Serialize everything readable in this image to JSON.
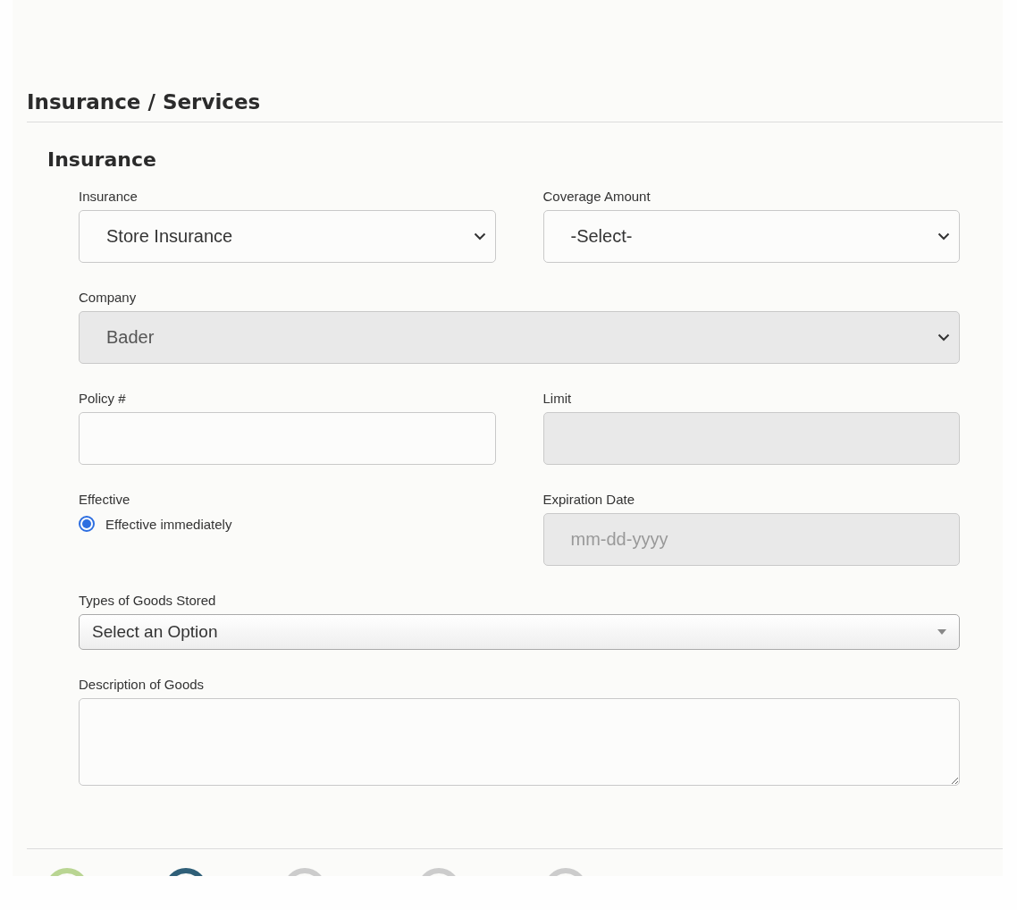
{
  "section_title": "Insurance / Services",
  "subsection_title": "Insurance",
  "rows": [
    [
      {
        "kind": "select",
        "label": "Insurance",
        "value": "Store Insurance",
        "disabled": false
      },
      {
        "kind": "select",
        "label": "Coverage Amount",
        "value": "-Select-",
        "disabled": false
      }
    ],
    [
      {
        "kind": "select",
        "label": "Company",
        "value": "Bader",
        "disabled": true
      }
    ],
    [
      {
        "kind": "input",
        "label": "Policy #",
        "disabled": false
      },
      {
        "kind": "input",
        "label": "Limit",
        "disabled": true
      }
    ],
    [
      {
        "kind": "radio",
        "label": "Effective",
        "option": "Effective immediately",
        "selected": true
      },
      {
        "kind": "input",
        "label": "Expiration Date",
        "placeholder": "mm-dd-yyyy",
        "disabled": true
      }
    ],
    [
      {
        "kind": "combo",
        "label": "Types of Goods Stored",
        "value": "Select an Option",
        "disabled": false
      }
    ],
    [
      {
        "kind": "textarea",
        "label": "Description of Goods",
        "disabled": false
      }
    ]
  ],
  "steps": [
    {
      "color": "#b9d592"
    },
    {
      "color": "#2f5f78"
    },
    {
      "color": "#cccccc"
    },
    {
      "color": "#cccccc"
    },
    {
      "color": "#cccccc"
    }
  ]
}
